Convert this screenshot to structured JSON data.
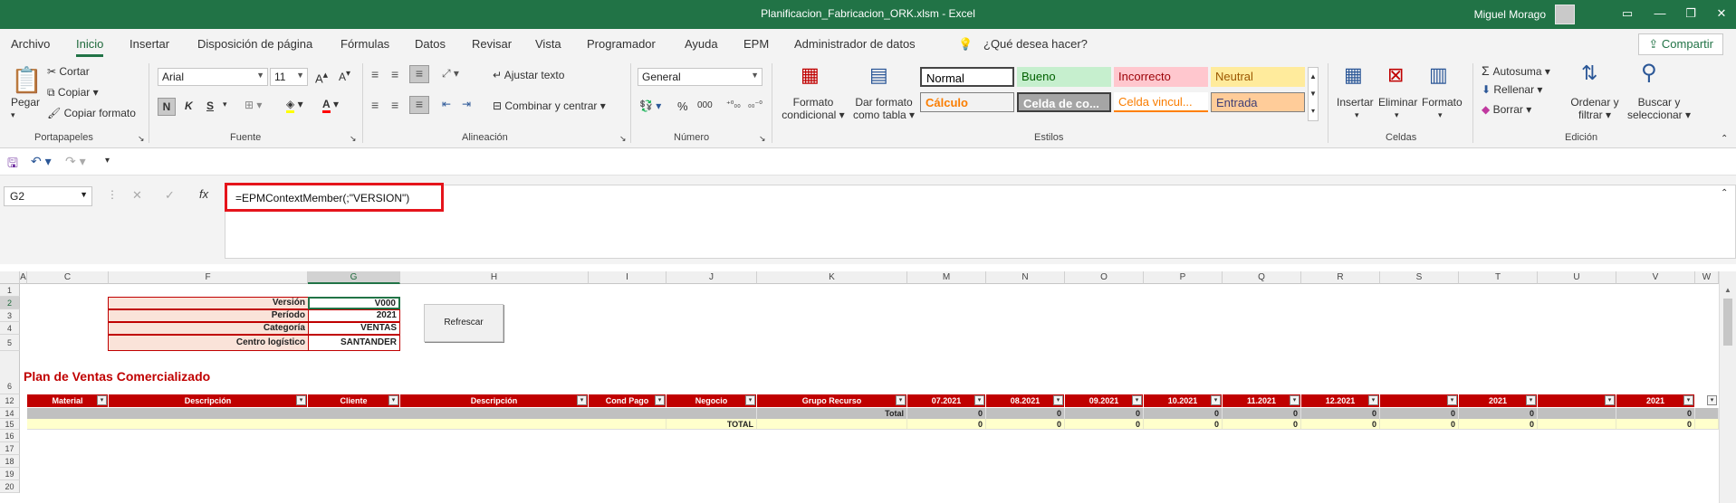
{
  "window": {
    "title": "Planificacion_Fabricacion_ORK.xlsm  -  Excel",
    "user": "Miguel Morago"
  },
  "tabs": [
    "Archivo",
    "Inicio",
    "Insertar",
    "Disposición de página",
    "Fórmulas",
    "Datos",
    "Revisar",
    "Vista",
    "Programador",
    "Ayuda",
    "EPM",
    "Administrador de datos"
  ],
  "active_tab": "Inicio",
  "tell_me": "¿Qué desea hacer?",
  "share": "Compartir",
  "ribbon": {
    "clipboard": {
      "paste": "Pegar",
      "cut": "Cortar",
      "copy": "Copiar",
      "format_painter": "Copiar formato",
      "label": "Portapapeles"
    },
    "font": {
      "name": "Arial",
      "size": "11",
      "bold": "N",
      "italic": "K",
      "underline": "S",
      "label": "Fuente"
    },
    "alignment": {
      "wrap": "Ajustar texto",
      "merge": "Combinar y centrar",
      "label": "Alineación"
    },
    "number": {
      "format": "General",
      "label": "Número"
    },
    "styles": {
      "conditional": "Formato condicional",
      "table": "Dar formato como tabla",
      "label": "Estilos",
      "cells": [
        {
          "name": "Normal",
          "bg": "#ffffff",
          "fg": "#000000"
        },
        {
          "name": "Bueno",
          "bg": "#c6efce",
          "fg": "#006100"
        },
        {
          "name": "Incorrecto",
          "bg": "#ffc7ce",
          "fg": "#9c0006"
        },
        {
          "name": "Neutral",
          "bg": "#ffeb9c",
          "fg": "#9c5700"
        },
        {
          "name": "Cálculo",
          "bg": "#f2f2f2",
          "fg": "#fa7d00"
        },
        {
          "name": "Celda de co...",
          "bg": "#a5a5a5",
          "fg": "#ffffff"
        },
        {
          "name": "Celda vincul...",
          "bg": "#ffffff",
          "fg": "#fa7d00"
        },
        {
          "name": "Entrada",
          "bg": "#ffcc99",
          "fg": "#3f3f76"
        }
      ]
    },
    "cells": {
      "insert": "Insertar",
      "delete": "Eliminar",
      "format": "Formato",
      "label": "Celdas"
    },
    "editing": {
      "autosum": "Autosuma",
      "fill": "Rellenar",
      "clear": "Borrar",
      "sort": "Ordenar y filtrar",
      "find": "Buscar y seleccionar",
      "label": "Edición"
    }
  },
  "namebox": "G2",
  "formula": "=EPMContextMember(;\"VERSION\")",
  "grid": {
    "columns": [
      "A",
      "C",
      "F",
      "G",
      "H",
      "I",
      "J",
      "K",
      "M",
      "N",
      "O",
      "P",
      "Q",
      "R",
      "S",
      "T",
      "U",
      "V",
      "W"
    ],
    "selected_column": "G",
    "rows": [
      "1",
      "2",
      "3",
      "4",
      "5",
      "6",
      "12",
      "14",
      "15",
      "16",
      "17",
      "18",
      "19",
      "20"
    ],
    "selected_row": "2",
    "params": [
      {
        "label": "Versión",
        "value": "V000"
      },
      {
        "label": "Período",
        "value": "2021"
      },
      {
        "label": "Categoría",
        "value": "VENTAS"
      },
      {
        "label": "Centro logístico",
        "value": "SANTANDER"
      }
    ],
    "refresh_button": "Refrescar",
    "section_title": "Plan de Ventas Comercializado",
    "table_headers": [
      "Material",
      "Descripción",
      "Cliente",
      "Descripción",
      "Cond Pago",
      "Negocio",
      "Grupo Recurso",
      "07.2021",
      "08.2021",
      "09.2021",
      "10.2021",
      "11.2021",
      "12.2021",
      "",
      "2021",
      "",
      "2021",
      ""
    ],
    "total_label": "Total",
    "grand_total_label": "TOTAL",
    "row14_values": [
      "0",
      "0",
      "0",
      "0",
      "0",
      "0",
      "0",
      "0",
      "0"
    ],
    "row15_values": [
      "0",
      "0",
      "0",
      "0",
      "0",
      "0",
      "0",
      "0",
      "0"
    ]
  }
}
